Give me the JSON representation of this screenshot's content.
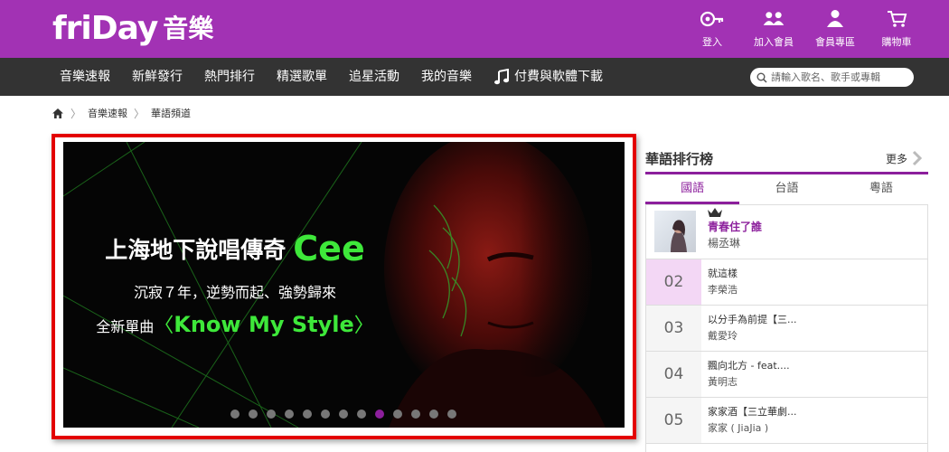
{
  "header": {
    "logo_word": "friDay",
    "logo_cn": "音樂",
    "buttons": [
      {
        "label": "登入",
        "icon": "login-icon"
      },
      {
        "label": "加入會員",
        "icon": "join-member-icon"
      },
      {
        "label": "會員專區",
        "icon": "member-icon"
      },
      {
        "label": "購物車",
        "icon": "cart-icon"
      }
    ]
  },
  "nav": {
    "items": [
      "音樂速報",
      "新鮮發行",
      "熱門排行",
      "精選歌單",
      "追星活動",
      "我的音樂"
    ],
    "download_label": "付費與軟體下載",
    "search_placeholder": "請輸入歌名、歌手或專輯"
  },
  "breadcrumb": [
    "音樂速報",
    "華語頻道"
  ],
  "banner": {
    "title": "上海地下說唱傳奇",
    "artist": "Cee",
    "subtitle": "沉寂７年，逆勢而起、強勢歸來",
    "single_prefix": "全新單曲",
    "bracket_open": "〈",
    "single_name": "Know My Style",
    "bracket_close": "〉",
    "dot_count": 13,
    "active_dot": 8
  },
  "chart_panel": {
    "title": "華語排行榜",
    "more_label": "更多",
    "tabs": [
      "國語",
      "台語",
      "粵語"
    ],
    "active_tab": 0,
    "top": {
      "song": "青春住了誰",
      "artist": "楊丞琳"
    },
    "rows": [
      {
        "rank": "02",
        "song": "就這樣",
        "artist": "李榮浩"
      },
      {
        "rank": "03",
        "song": "以分手為前提【三...",
        "artist": "戴愛玲"
      },
      {
        "rank": "04",
        "song": "飄向北方 - feat....",
        "artist": "黃明志"
      },
      {
        "rank": "05",
        "song": "家家酒【三立華劇...",
        "artist": "家家 ( JiaJia )"
      }
    ]
  },
  "colors": {
    "brand_purple": "#a232b4",
    "accent_purple": "#8c1f9c",
    "nav_dark": "#333333",
    "banner_green": "#3ee83a",
    "frame_red": "#e30000"
  }
}
